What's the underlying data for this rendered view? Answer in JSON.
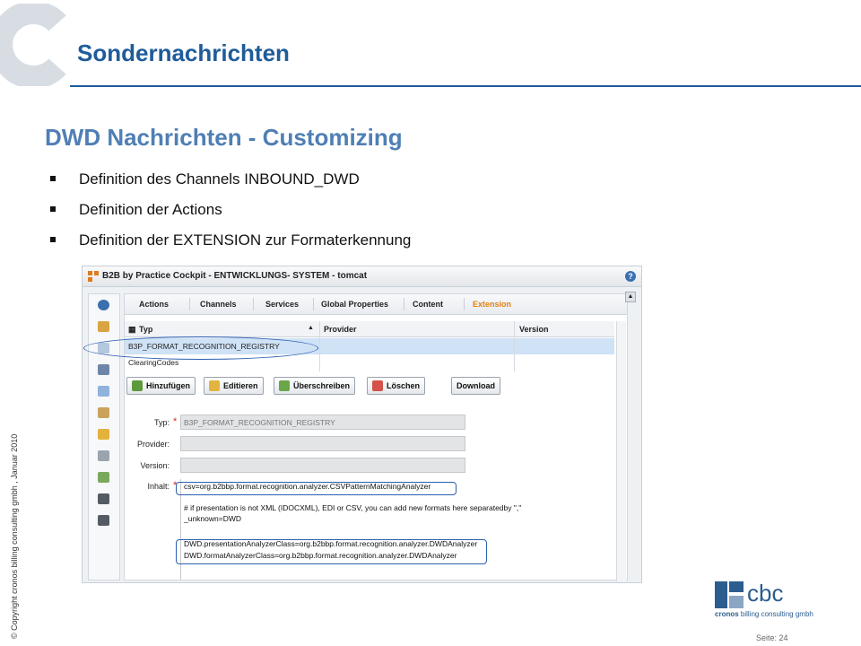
{
  "slide": {
    "title": "Sondernachrichten",
    "subtitle": "DWD Nachrichten - Customizing",
    "bullets": [
      "Definition des Channels INBOUND_DWD",
      "Definition der Actions",
      "Definition der EXTENSION zur Formaterkennung"
    ],
    "copyright": "© Copyright cronos billing consulting gmbh , Januar 2010",
    "page_label": "Seite: 24",
    "logo": {
      "name": "cbc",
      "brand": "cronos",
      "tagline": "billing consulting gmbh"
    },
    "colors": {
      "primary": "#1f5c99",
      "secondary": "#4f7fb5",
      "highlight": "#2a5fb0",
      "active_tab": "#e08010"
    }
  },
  "app": {
    "window_title": "B2B by Practice Cockpit - ENTWICKLUNGS- SYSTEM - tomcat",
    "tabs": [
      "Actions",
      "Channels",
      "Services",
      "Global Properties",
      "Content",
      "Extension"
    ],
    "active_tab": "Extension",
    "grid": {
      "columns": [
        "Typ",
        "Provider",
        "Version"
      ],
      "rows": [
        {
          "typ": "B3P_FORMAT_RECOGNITION_REGISTRY",
          "provider": "",
          "version": "",
          "selected": true
        },
        {
          "typ": "ClearingCodes",
          "provider": "",
          "version": "",
          "selected": false
        }
      ]
    },
    "buttons": [
      "Hinzufügen",
      "Editieren",
      "Überschreiben",
      "Löschen",
      "Download"
    ],
    "form": {
      "typ_label": "Typ:",
      "typ_value": "B3P_FORMAT_RECOGNITION_REGISTRY",
      "provider_label": "Provider:",
      "version_label": "Version:",
      "inhalt_label": "Inhalt:",
      "inhalt_lines": [
        "csv=org.b2bbp.format.recognition.analyzer.CSVPatternMatchingAnalyzer",
        "# if presentation is not XML (IDOCXML), EDI or CSV, you can add new formats here separatedby \",\"",
        "_unknown=DWD",
        "DWD.presentationAnalyzerClass=org.b2bbp.format.recognition.analyzer.DWDAnalyzer",
        "DWD.formatAnalyzerClass=org.b2bbp.format.recognition.analyzer.DWDAnalyzer"
      ]
    }
  }
}
